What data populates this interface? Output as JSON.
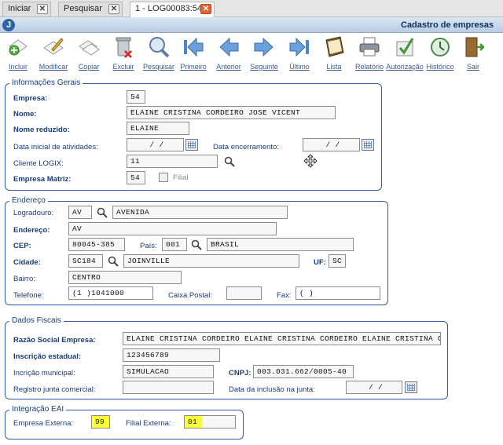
{
  "tabs": [
    {
      "label": "Iniciar"
    },
    {
      "label": "Pesquisar"
    },
    {
      "label": "1 - LOG00083:54"
    }
  ],
  "window": {
    "title": "Cadastro de empresas"
  },
  "toolbar": [
    {
      "label": "Incluir",
      "icon": "add-icon"
    },
    {
      "label": "Modificar",
      "icon": "edit-icon"
    },
    {
      "label": "Copiar",
      "icon": "copy-icon"
    },
    {
      "label": "Excluir",
      "icon": "delete-icon"
    },
    {
      "label": "Pesquisar",
      "icon": "search-icon"
    },
    {
      "label": "Primeiro",
      "icon": "first-icon"
    },
    {
      "label": "Anterior",
      "icon": "previous-icon"
    },
    {
      "label": "Seguinte",
      "icon": "next-icon"
    },
    {
      "label": "Último",
      "icon": "last-icon"
    },
    {
      "label": "Lista",
      "icon": "list-icon"
    },
    {
      "label": "Relatório",
      "icon": "printer-icon"
    },
    {
      "label": "Autorização",
      "icon": "authorization-icon"
    },
    {
      "label": "Histórico",
      "icon": "history-icon"
    },
    {
      "label": "Sair",
      "icon": "exit-icon"
    }
  ],
  "gerais": {
    "title": "Informações Gerais",
    "empresa_label": "Empresa:",
    "empresa": "54",
    "nome_label": "Nome:",
    "nome": "ELAINE CRISTINA CORDEIRO JOSE VICENT",
    "nome_reduzido_label": "Nome reduzido:",
    "nome_reduzido": "ELAINE",
    "data_inicial_label": "Data inicial de atividades:",
    "data_inicial": "/ /",
    "data_encerramento_label": "Data encerramento:",
    "data_encerramento": "/ /",
    "cliente_label": "Cliente LOGIX:",
    "cliente": "11",
    "matriz_label": "Empresa Matriz:",
    "matriz": "54",
    "filial_label": "Filial"
  },
  "endereco": {
    "title": "Endereço",
    "logradouro_label": "Logradouro:",
    "logradouro_cod": "AV",
    "logradouro_desc": "AVENIDA",
    "endereco_label": "Endereço:",
    "endereco": "AV",
    "cep_label": "CEP:",
    "cep": "80045-385",
    "pais_label": "País:",
    "pais_cod": "001",
    "pais_desc": "BRASIL",
    "cidade_label": "Cidade:",
    "cidade_cod": "SC184",
    "cidade_desc": "JOINVILLE",
    "uf_label": "UF:",
    "uf": "SC",
    "bairro_label": "Bairro:",
    "bairro": "CENTRO",
    "telefone_label": "Telefone:",
    "telefone": "(1 )1041000",
    "caixa_postal_label": "Caixa Postal:",
    "caixa_postal": "",
    "fax_label": "Fax:",
    "fax": "( )"
  },
  "fiscais": {
    "title": "Dados Fiscais",
    "razao_label": "Razão Social Empresa:",
    "razao": "ELAINE CRISTINA CORDEIRO ELAINE CRISTINA CORDEIRO ELAINE CRISTINA CC",
    "ie_label": "Inscrição estadual:",
    "ie": "123456789",
    "im_label": "Incrição municipal:",
    "im": "SIMULACAO",
    "cnpj_label": "CNPJ:",
    "cnpj": "003.031.662/0005-40",
    "junta_label": "Registro junta comercial:",
    "junta": "",
    "data_inclusao_label": "Data da inclusão na junta:",
    "data_inclusao": "/ /"
  },
  "eai": {
    "title": "Integração EAI",
    "empresa_ext_label": "Empresa Externa:",
    "empresa_ext": "99",
    "filial_ext_label": "Filial Externa:",
    "filial_ext": "01"
  }
}
